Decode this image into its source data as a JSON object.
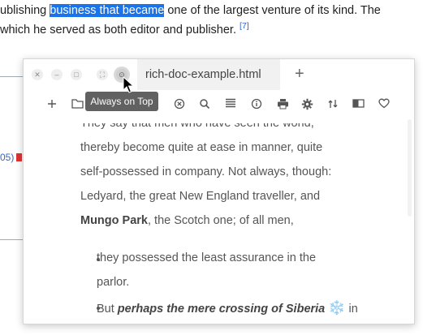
{
  "background_page": {
    "line1_pre": "ublishing ",
    "line1_highlight": "business that became",
    "line1_post": " one of the largest venture of its kind. The",
    "line2_text": " which he served as both editor and publisher. ",
    "line2_cite": "[7]",
    "side_ref": "05)"
  },
  "window": {
    "tab_title": "rich-doc-example.html",
    "new_tab_glyph": "+",
    "tooltip": "Always on Top"
  },
  "toolbar": {
    "icons": [
      "plus-icon",
      "folder-icon",
      "close-circle-icon",
      "search-icon",
      "list-icon",
      "info-icon",
      "print-icon",
      "gear-icon",
      "swap-icon",
      "book-icon",
      "heart-icon"
    ]
  },
  "content": {
    "line0": "They say that men who have seen the world,",
    "line1": "thereby become quite at ease in manner, quite",
    "line2": "self-possessed in company. Not always, though:",
    "line3": "Ledyard, the great New England traveller, and",
    "line4_bold": "Mungo Park",
    "line4_rest": ", the Scotch one; of all men,",
    "bullet1_line1": "they possessed the least assurance in the",
    "bullet1_line2": "parlor.",
    "bullet2_pre": "But ",
    "bullet2_bold_italic": "perhaps the mere crossing of Siberia",
    "bullet2_emoji": "❄️",
    "bullet2_post": " in"
  },
  "colors": {
    "highlight": "#1a73e8",
    "link": "#3366cc",
    "tooltip_bg": "#616161"
  }
}
